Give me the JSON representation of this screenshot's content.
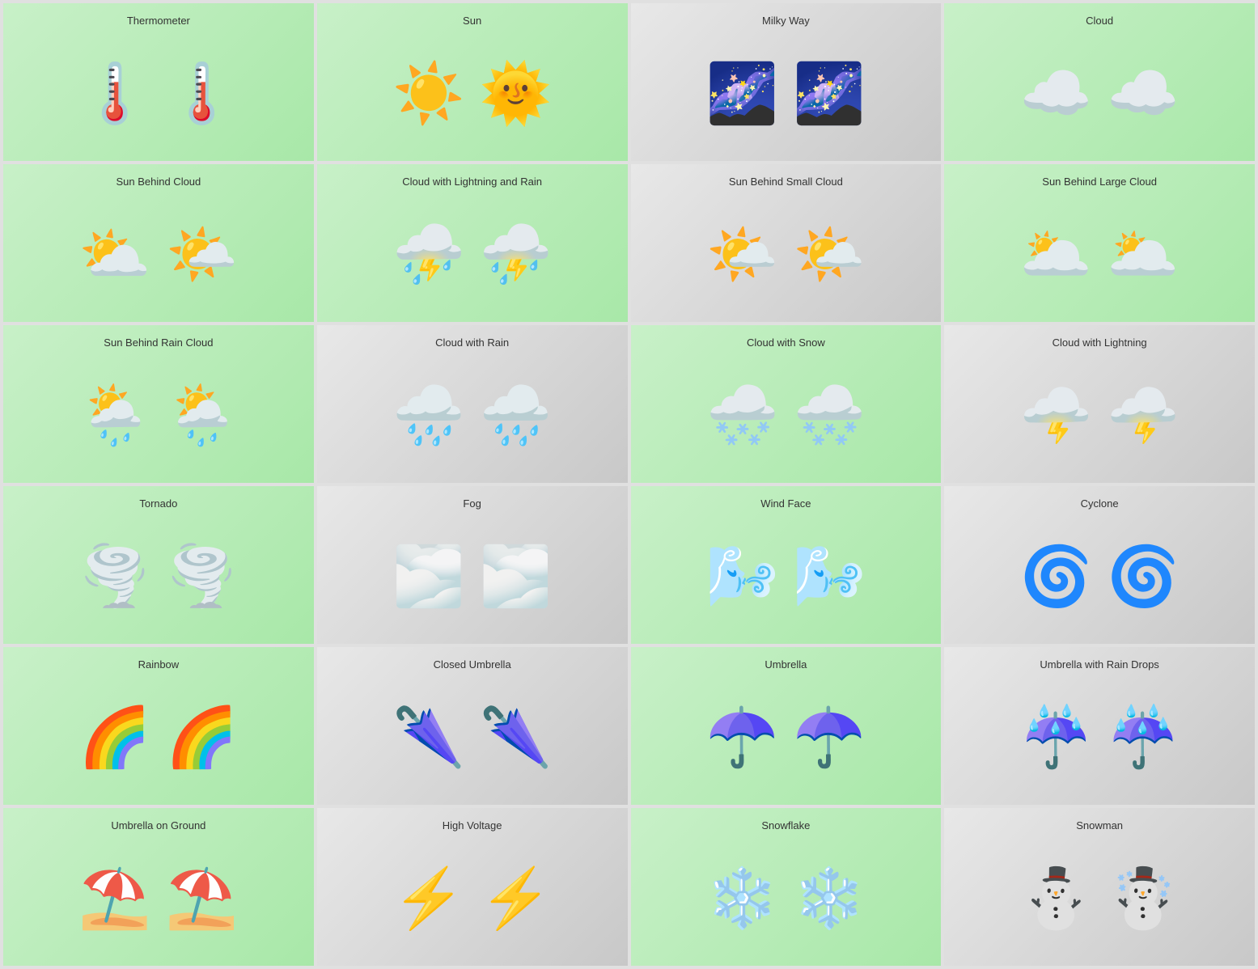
{
  "cells": [
    {
      "title": "Thermometer",
      "bg": "green",
      "emojis": [
        "🌡️",
        "🌡️"
      ]
    },
    {
      "title": "Sun",
      "bg": "green",
      "emojis": [
        "☀️",
        "🌞"
      ]
    },
    {
      "title": "Milky Way",
      "bg": "gray",
      "emojis": [
        "🌌",
        "🌌"
      ]
    },
    {
      "title": "Cloud",
      "bg": "green",
      "emojis": [
        "☁️",
        "☁️"
      ]
    },
    {
      "title": "Sun Behind Cloud",
      "bg": "green",
      "emojis": [
        "⛅",
        "🌤️"
      ]
    },
    {
      "title": "Cloud with Lightning and Rain",
      "bg": "green",
      "emojis": [
        "⛈️",
        "⛈️"
      ]
    },
    {
      "title": "Sun Behind Small Cloud",
      "bg": "gray",
      "emojis": [
        "🌤️",
        "🌤️"
      ]
    },
    {
      "title": "Sun Behind Large Cloud",
      "bg": "green",
      "emojis": [
        "🌥️",
        "🌥️"
      ]
    },
    {
      "title": "Sun Behind Rain Cloud",
      "bg": "green",
      "emojis": [
        "🌦️",
        "🌦️"
      ]
    },
    {
      "title": "Cloud with Rain",
      "bg": "gray",
      "emojis": [
        "🌧️",
        "🌧️"
      ]
    },
    {
      "title": "Cloud with Snow",
      "bg": "green",
      "emojis": [
        "🌨️",
        "🌨️"
      ]
    },
    {
      "title": "Cloud with Lightning",
      "bg": "gray",
      "emojis": [
        "🌩️",
        "🌩️"
      ]
    },
    {
      "title": "Tornado",
      "bg": "green",
      "emojis": [
        "🌪️",
        "🌪️"
      ]
    },
    {
      "title": "Fog",
      "bg": "gray",
      "emojis": [
        "🌫️",
        "🌫️"
      ]
    },
    {
      "title": "Wind Face",
      "bg": "green",
      "emojis": [
        "🌬️",
        "🌬️"
      ]
    },
    {
      "title": "Cyclone",
      "bg": "gray",
      "emojis": [
        "🌀",
        "🌀"
      ]
    },
    {
      "title": "Rainbow",
      "bg": "green",
      "emojis": [
        "🌈",
        "🌈"
      ]
    },
    {
      "title": "Closed Umbrella",
      "bg": "gray",
      "emojis": [
        "🌂",
        "🌂"
      ]
    },
    {
      "title": "Umbrella",
      "bg": "green",
      "emojis": [
        "☂️",
        "☂️"
      ]
    },
    {
      "title": "Umbrella with Rain Drops",
      "bg": "gray",
      "emojis": [
        "☔",
        "☔"
      ]
    },
    {
      "title": "Umbrella on Ground",
      "bg": "green",
      "emojis": [
        "⛱️",
        "⛱️"
      ]
    },
    {
      "title": "High Voltage",
      "bg": "gray",
      "emojis": [
        "⚡",
        "⚡"
      ]
    },
    {
      "title": "Snowflake",
      "bg": "green",
      "emojis": [
        "❄️",
        "❄️"
      ]
    },
    {
      "title": "Snowman",
      "bg": "gray",
      "emojis": [
        "⛄",
        "☃️"
      ]
    }
  ]
}
